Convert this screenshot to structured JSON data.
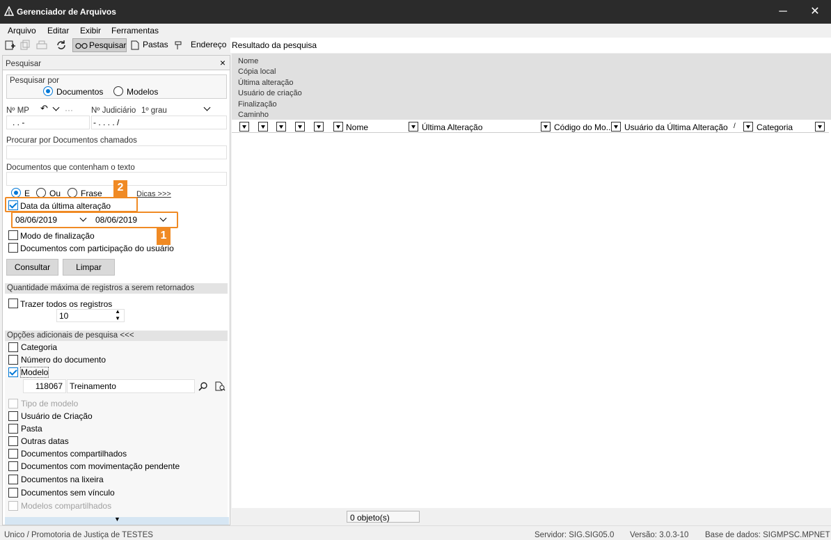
{
  "window": {
    "title": "Gerenciador de Arquivos",
    "minimize": "─",
    "close": "✕"
  },
  "menu": [
    "Arquivo",
    "Editar",
    "Exibir",
    "Ferramentas"
  ],
  "toolbar": {
    "search": "Pesquisar",
    "folders": "Pastas",
    "address_label": "Endereço",
    "address_value": "Resultado da pesquisa"
  },
  "panel": {
    "title": "Pesquisar",
    "close": "×",
    "search_by": {
      "label": "Pesquisar por",
      "options": [
        "Documentos",
        "Modelos"
      ],
      "selected": "Documentos"
    },
    "mp": {
      "label": "Nº MP",
      "value": ". .     -",
      "extra": "···"
    },
    "judicial": {
      "label": "Nº Judiciário",
      "grade": "1º grau",
      "value": "- .   . . .    /"
    },
    "docs_named": {
      "label": "Procurar por Documentos chamados",
      "value": ""
    },
    "docs_text": {
      "label": "Documentos que contenham o texto",
      "value": ""
    },
    "logic": {
      "options": [
        "E",
        "Ou",
        "Frase"
      ],
      "selected": "E",
      "tips": "Dicas >>>"
    },
    "last_change": {
      "label": "Data da última alteração",
      "checked": true,
      "from": "08/06/2019",
      "to": "08/06/2019"
    },
    "finalization": {
      "label": "Modo de finalização",
      "checked": false
    },
    "user_docs": {
      "label": "Documentos com participação do usuário",
      "checked": false
    },
    "buttons": {
      "consult": "Consultar",
      "clear": "Limpar"
    },
    "max_records": {
      "title": "Quantidade máxima de registros a serem retornados",
      "all_label": "Trazer todos os registros",
      "value": "10"
    },
    "extra_options": {
      "title": "Opções adicionais de pesquisa <<<",
      "items": [
        {
          "label": "Categoria",
          "checked": false,
          "disabled": false
        },
        {
          "label": "Número do documento",
          "checked": false,
          "disabled": false
        },
        {
          "label": "Modelo",
          "checked": true,
          "disabled": false
        }
      ],
      "model": {
        "code": "118067",
        "name": "Treinamento"
      },
      "items2": [
        {
          "label": "Tipo de modelo",
          "checked": false,
          "disabled": true
        },
        {
          "label": "Usuário de Criação",
          "checked": false,
          "disabled": false
        },
        {
          "label": "Pasta",
          "checked": false,
          "disabled": false
        },
        {
          "label": "Outras datas",
          "checked": false,
          "disabled": false
        },
        {
          "label": "Documentos compartilhados",
          "checked": false,
          "disabled": false
        },
        {
          "label": "Documentos com movimentação pendente",
          "checked": false,
          "disabled": false
        },
        {
          "label": "Documentos na lixeira",
          "checked": false,
          "disabled": false
        },
        {
          "label": "Documentos sem vínculo",
          "checked": false,
          "disabled": false
        },
        {
          "label": "Modelos compartilhados",
          "checked": false,
          "disabled": true
        }
      ]
    }
  },
  "annotations": {
    "badge1": "1",
    "badge2": "2"
  },
  "results": {
    "properties": [
      "Nome",
      "Cópia local",
      "Última alteração",
      "Usuário de criação",
      "Finalização",
      "Caminho"
    ],
    "columns": [
      "Nome",
      "Última Alteração",
      "Código do Mo...",
      "Usuário da Última Alteração",
      "Categoria"
    ],
    "sort_mark": "/",
    "status": "0 objeto(s)"
  },
  "statusbar": {
    "left": "Unico / Promotoria de Justiça de TESTES",
    "server": "Servidor: SIG.SIG05.0",
    "version": "Versão: 3.0.3-10",
    "db": "Base de dados: SIGMPSC.MPNET"
  },
  "colors": {
    "accent": "#0078d7",
    "annotation": "#f08a24",
    "titlebar": "#2b2b2b"
  }
}
